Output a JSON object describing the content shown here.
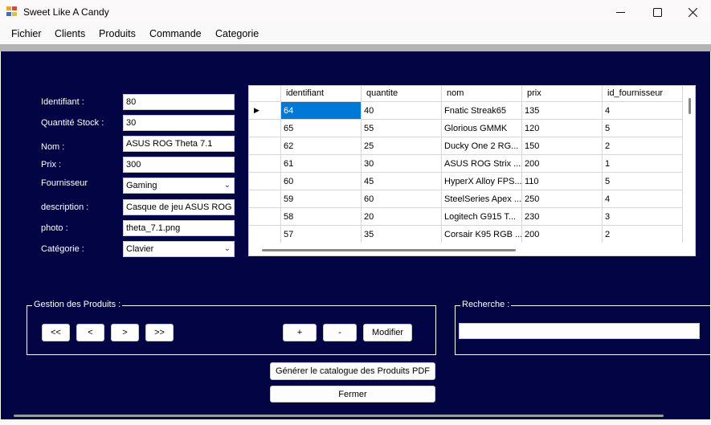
{
  "window": {
    "title": "Sweet Like A Candy",
    "icons": [
      "app-icon",
      "minimize-icon",
      "maximize-icon",
      "close-icon"
    ]
  },
  "menu": [
    "Fichier",
    "Clients",
    "Produits",
    "Commande",
    "Categorie"
  ],
  "form": {
    "identifiant": {
      "label": "Identifiant :",
      "value": "80"
    },
    "quantite": {
      "label": "Quantité Stock :",
      "value": "30"
    },
    "nom": {
      "label": "Nom :",
      "value": "ASUS ROG Theta 7.1"
    },
    "prix": {
      "label": "Prix :",
      "value": "300"
    },
    "fournisseur": {
      "label": "Fournisseur",
      "value": "Gaming"
    },
    "description": {
      "label": "description :",
      "value": "Casque de jeu ASUS ROG a"
    },
    "photo": {
      "label": "photo :",
      "value": "theta_7.1.png"
    },
    "categorie": {
      "label": "Catégorie :",
      "value": "Clavier"
    }
  },
  "grid": {
    "columns": [
      "identifiant",
      "quantite",
      "nom",
      "prix",
      "id_fournisseur"
    ],
    "rows": [
      [
        "64",
        "40",
        "Fnatic Streak65",
        "135",
        "4"
      ],
      [
        "65",
        "55",
        "Glorious GMMK",
        "120",
        "5"
      ],
      [
        "62",
        "25",
        "Ducky One 2 RG...",
        "150",
        "2"
      ],
      [
        "61",
        "30",
        "ASUS ROG Strix ...",
        "200",
        "1"
      ],
      [
        "60",
        "45",
        "HyperX Alloy FPS...",
        "110",
        "5"
      ],
      [
        "59",
        "60",
        "SteelSeries Apex ...",
        "250",
        "4"
      ],
      [
        "58",
        "20",
        "Logitech G915 T...",
        "230",
        "3"
      ],
      [
        "57",
        "35",
        "Corsair K95 RGB ...",
        "200",
        "2"
      ]
    ]
  },
  "gestion": {
    "title": "Gestion des Produits :",
    "first": "<<",
    "prev": "<",
    "next": ">",
    "last": ">>",
    "add": "+",
    "remove": "-",
    "modify": "Modifier"
  },
  "recherche": {
    "title": "Recherche :",
    "value": ""
  },
  "buttons": {
    "pdf": "Générer le catalogue des Produits PDF",
    "close": "Fermer"
  }
}
